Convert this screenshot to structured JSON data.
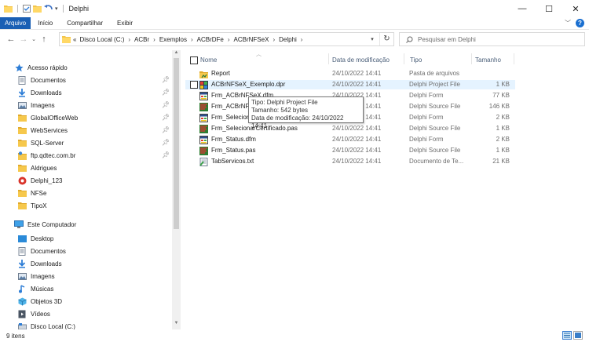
{
  "window": {
    "title": "Delphi",
    "controls": {
      "minimize": "—",
      "maximize": "☐",
      "close": "✕"
    }
  },
  "ribbon": {
    "tabs": [
      "Arquivo",
      "Início",
      "Compartilhar",
      "Exibir"
    ],
    "help": "?"
  },
  "address": {
    "back": "←",
    "forward": "→",
    "up": "↑",
    "overflow": "«",
    "crumbs": [
      "Disco Local (C:)",
      "ACBr",
      "Exemplos",
      "ACBrDFe",
      "ACBrNFSeX",
      "Delphi"
    ],
    "separator": "›",
    "refresh": "↻"
  },
  "search": {
    "placeholder": "Pesquisar em Delphi"
  },
  "nav": {
    "quick_access": {
      "label": "Acesso rápido",
      "items": [
        {
          "label": "Documentos",
          "icon": "documents-icon",
          "pinned": true
        },
        {
          "label": "Downloads",
          "icon": "download-icon",
          "pinned": true
        },
        {
          "label": "Imagens",
          "icon": "pictures-icon",
          "pinned": true
        },
        {
          "label": "GlobalOfficeWeb",
          "icon": "folder-icon",
          "pinned": true
        },
        {
          "label": "WebServices",
          "icon": "folder-icon",
          "pinned": true
        },
        {
          "label": "SQL-Server",
          "icon": "folder-icon",
          "pinned": true
        },
        {
          "label": "ftp.qdtec.com.br",
          "icon": "ftp-folder-icon",
          "pinned": true
        },
        {
          "label": "Aldrigues",
          "icon": "folder-icon",
          "pinned": false
        },
        {
          "label": "Delphi_123",
          "icon": "delphi-icon",
          "pinned": false
        },
        {
          "label": "NFSe",
          "icon": "folder-icon",
          "pinned": false
        },
        {
          "label": "TipoX",
          "icon": "folder-icon",
          "pinned": false
        }
      ]
    },
    "this_pc": {
      "label": "Este Computador",
      "items": [
        {
          "label": "Desktop",
          "icon": "desktop-icon"
        },
        {
          "label": "Documentos",
          "icon": "documents-icon"
        },
        {
          "label": "Downloads",
          "icon": "download-icon"
        },
        {
          "label": "Imagens",
          "icon": "pictures-icon"
        },
        {
          "label": "Músicas",
          "icon": "music-icon"
        },
        {
          "label": "Objetos 3D",
          "icon": "3d-objects-icon"
        },
        {
          "label": "Vídeos",
          "icon": "videos-icon"
        },
        {
          "label": "Disco Local (C:)",
          "icon": "drive-icon"
        }
      ]
    }
  },
  "columns": {
    "name": "Nome",
    "date": "Data de modificação",
    "type": "Tipo",
    "size": "Tamanho"
  },
  "files": [
    {
      "name": "Report",
      "date": "24/10/2022 14:41",
      "type": "Pasta de arquivos",
      "size": "",
      "icon": "report-folder-icon"
    },
    {
      "name": "ACBrNFSeX_Exemplo.dpr",
      "date": "24/10/2022 14:41",
      "type": "Delphi Project File",
      "size": "1 KB",
      "icon": "dpr-file-icon"
    },
    {
      "name": "Frm_ACBrNFSeX.dfm",
      "date": "24/10/2022 14:41",
      "type": "Delphi Form",
      "size": "77 KB",
      "icon": "dfm-file-icon"
    },
    {
      "name": "Frm_ACBrNFSeX.pas",
      "date": "24/10/2022 14:41",
      "type": "Delphi Source File",
      "size": "146 KB",
      "icon": "pas-file-icon"
    },
    {
      "name": "Frm_SelecionarCertificado.dfm",
      "date": "24/10/2022 14:41",
      "type": "Delphi Form",
      "size": "2 KB",
      "icon": "dfm-file-icon"
    },
    {
      "name": "Frm_SelecionarCertificado.pas",
      "date": "24/10/2022 14:41",
      "type": "Delphi Source File",
      "size": "1 KB",
      "icon": "pas-file-icon"
    },
    {
      "name": "Frm_Status.dfm",
      "date": "24/10/2022 14:41",
      "type": "Delphi Form",
      "size": "2 KB",
      "icon": "dfm-file-icon"
    },
    {
      "name": "Frm_Status.pas",
      "date": "24/10/2022 14:41",
      "type": "Delphi Source File",
      "size": "1 KB",
      "icon": "pas-file-icon"
    },
    {
      "name": "TabServicos.txt",
      "date": "24/10/2022 14:41",
      "type": "Documento de Te...",
      "size": "21 KB",
      "icon": "txt-file-icon"
    }
  ],
  "tooltip": {
    "line1": "Tipo: Delphi Project File",
    "line2": "Tamanho: 542 bytes",
    "line3": "Data de modificação: 24/10/2022 14:41"
  },
  "status": {
    "count": "9 itens"
  },
  "colors": {
    "accent": "#1a5fb4",
    "selection": "#e5f3ff",
    "folder": "#f3c54b",
    "header_text": "#4c607a"
  }
}
